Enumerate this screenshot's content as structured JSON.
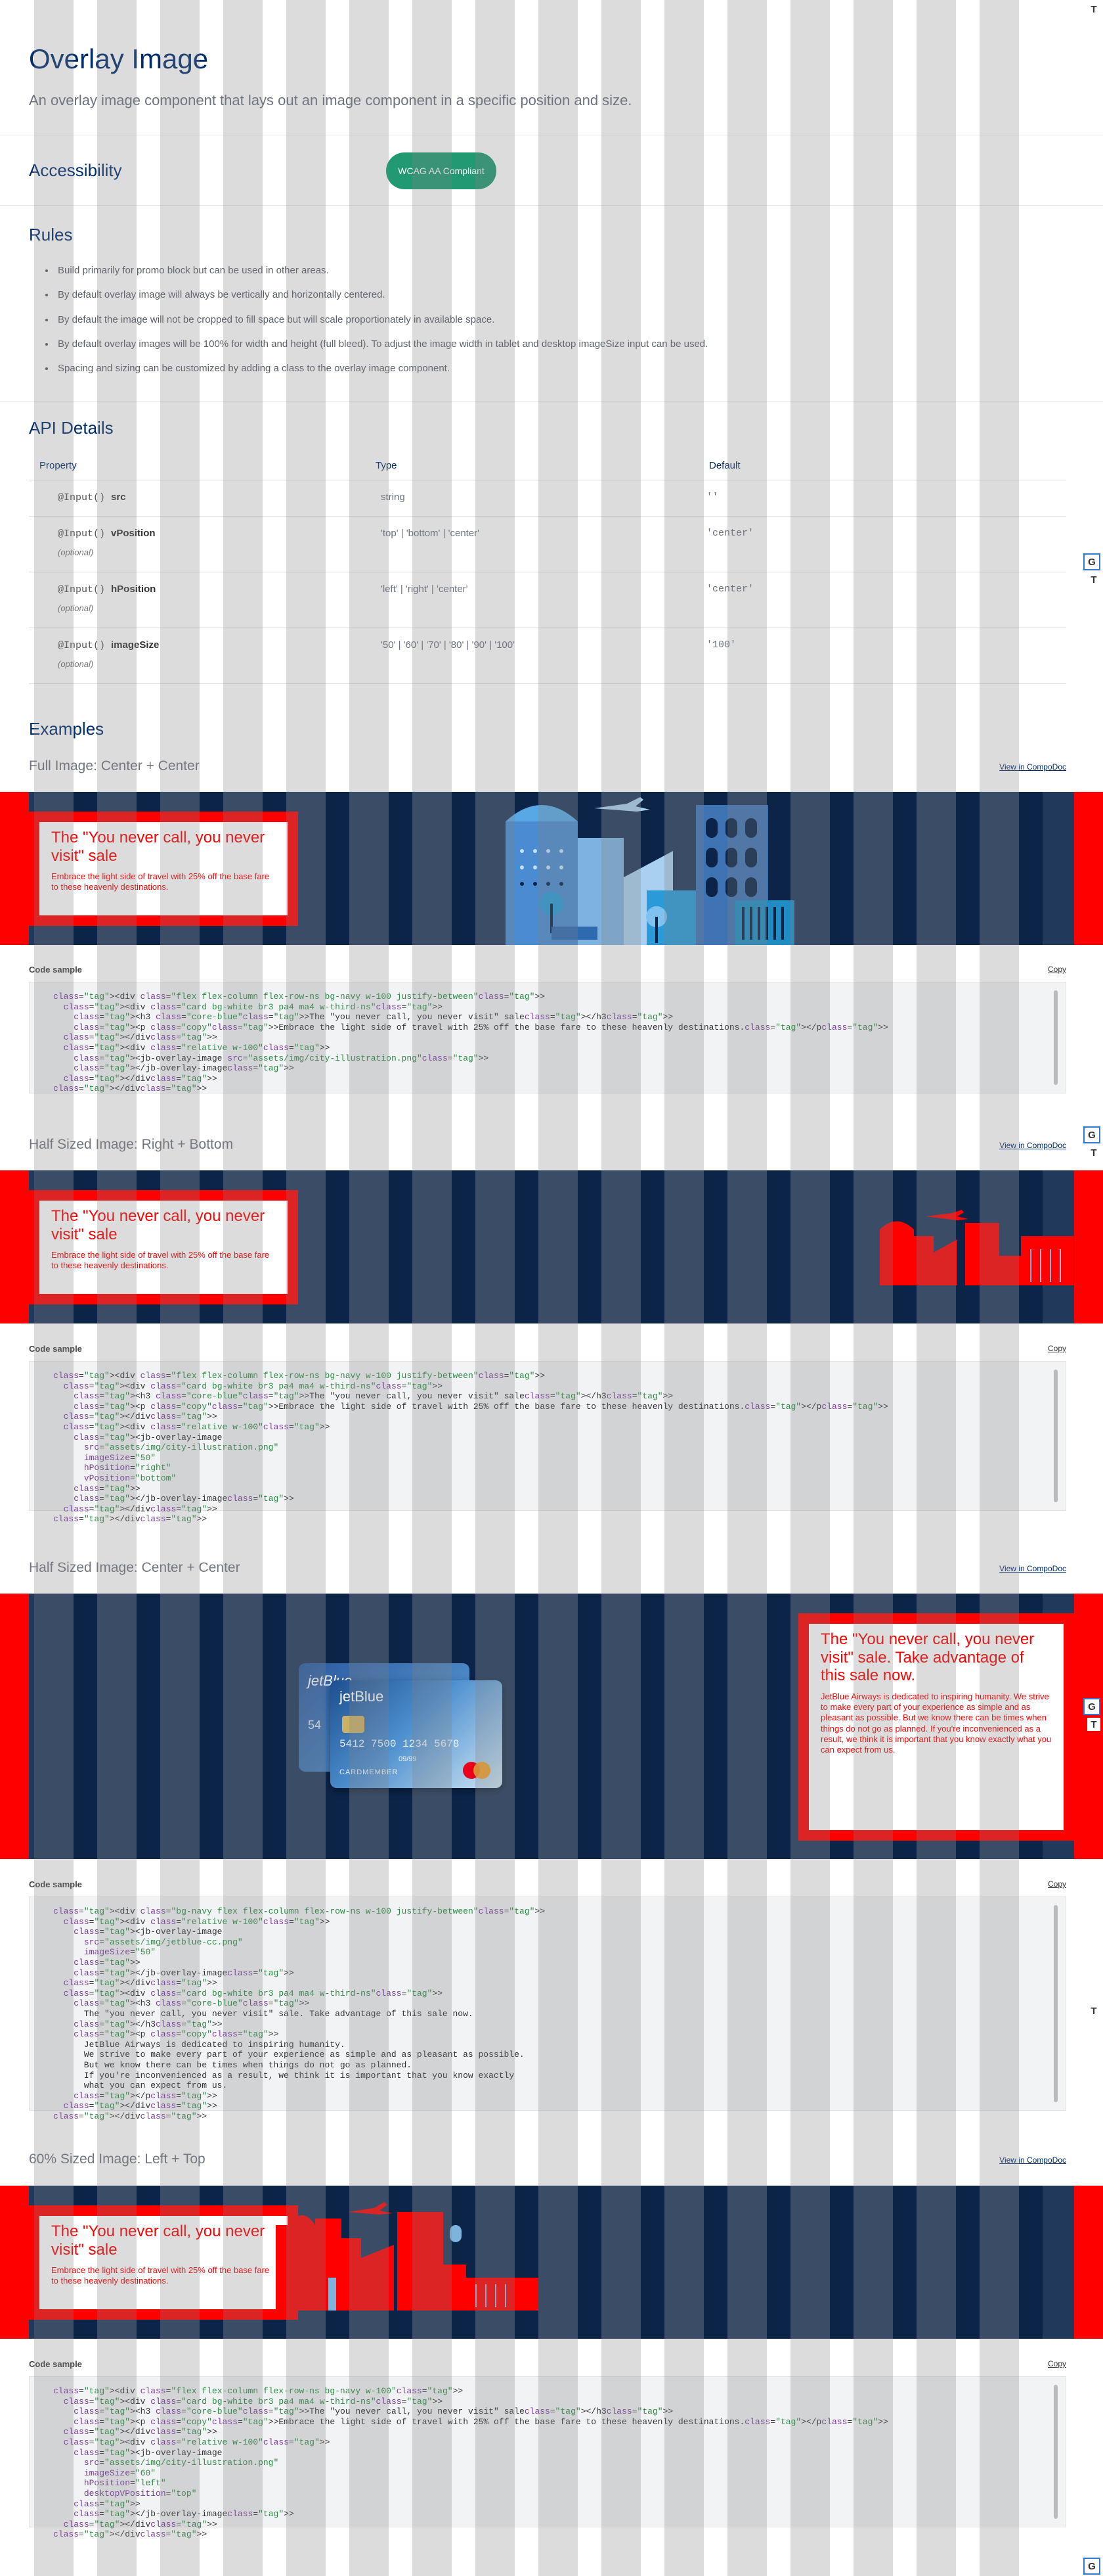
{
  "header": {
    "title": "Overlay Image",
    "lead": "An overlay image component that lays out an image component in a specific position and size."
  },
  "accessibility": {
    "title": "Accessibility",
    "badge": "WCAG AA Compliant"
  },
  "rules": {
    "title": "Rules",
    "items": [
      "Build primarily for promo block but can be used in other areas.",
      "By default overlay image will always be vertically and horizontally centered.",
      "By default the image will not be cropped to fill space but will scale proportionately in available space.",
      "By default overlay images will be 100% for width and height (full bleed). To adjust the image width in tablet and desktop imageSize input can be used.",
      "Spacing and sizing can be customized by adding a class to the overlay image component."
    ]
  },
  "api": {
    "title": "API Details",
    "columns": [
      "Property",
      "Type",
      "Default"
    ],
    "rows": [
      {
        "decorator": "@Input()",
        "name": "src",
        "optional": "",
        "type": "string",
        "default": "''"
      },
      {
        "decorator": "@Input()",
        "name": "vPosition",
        "optional": "(optional)",
        "type": "'top' | 'bottom' | 'center'",
        "default": "'center'"
      },
      {
        "decorator": "@Input()",
        "name": "hPosition",
        "optional": "(optional)",
        "type": "'left' | 'right' | 'center'",
        "default": "'center'"
      },
      {
        "decorator": "@Input()",
        "name": "imageSize",
        "optional": "(optional)",
        "type": "'50' | '60' | '70' | '80' | '90' | '100'",
        "default": "'100'"
      }
    ]
  },
  "examples": {
    "title": "Examples",
    "view_link": "View in CompoDoc",
    "code_label": "Code sample",
    "copy_label": "Copy",
    "card_title": "The \"You never call, you never visit\" sale",
    "card_copy": "Embrace the light side of travel with 25% off the base fare to these heavenly destinations.",
    "card_title_long": "The \"You never call, you never visit\" sale. Take advantage of this sale now.",
    "card_copy_long": "JetBlue Airways is dedicated to inspiring humanity. We strive to make every part of your experience as simple and as pleasant as possible. But we know there can be times when things do not go as planned. If you're inconvenienced as a result, we think it is important that you know exactly what you can expect from us.",
    "items": [
      {
        "title": "Full Image: Center + Center"
      },
      {
        "title": "Half Sized Image: Right + Bottom"
      },
      {
        "title": "Half Sized Image: Center + Center"
      },
      {
        "title": "60% Sized Image: Left + Top"
      }
    ]
  },
  "code": {
    "ex1": [
      "<div class=\"flex flex-column flex-row-ns bg-navy w-100 justify-between\">",
      "  <div class=\"card bg-white br3 pa4 ma4 w-third-ns\">",
      "    <h3 class=\"core-blue\">The \"you never call, you never visit\" sale</h3>",
      "    <p class=\"copy\">Embrace the light side of travel with 25% off the base fare to these heavenly destinations.</p>",
      "  </div>",
      "  <div class=\"relative w-100\">",
      "    <jb-overlay-image src=\"assets/img/city-illustration.png\">",
      "    </jb-overlay-image>",
      "  </div>",
      "</div>"
    ],
    "ex2": [
      "<div class=\"flex flex-column flex-row-ns bg-navy w-100 justify-between\">",
      "  <div class=\"card bg-white br3 pa4 ma4 w-third-ns\">",
      "    <h3 class=\"core-blue\">The \"you never call, you never visit\" sale</h3>",
      "    <p class=\"copy\">Embrace the light side of travel with 25% off the base fare to these heavenly destinations.</p>",
      "  </div>",
      "  <div class=\"relative w-100\">",
      "    <jb-overlay-image",
      "      src=\"assets/img/city-illustration.png\"",
      "      imageSize=\"50\"",
      "      hPosition=\"right\"",
      "      vPosition=\"bottom\"",
      "    >",
      "    </jb-overlay-image>",
      "  </div>",
      "</div>"
    ],
    "ex3": [
      "<div class=\"bg-navy flex flex-column flex-row-ns w-100 justify-between\">",
      "  <div class=\"relative w-100\">",
      "    <jb-overlay-image",
      "      src=\"assets/img/jetblue-cc.png\"",
      "      imageSize=\"50\"",
      "    >",
      "    </jb-overlay-image>",
      "  </div>",
      "  <div class=\"card bg-white br3 pa4 ma4 w-third-ns\">",
      "    <h3 class=\"core-blue\">",
      "      The \"you never call, you never visit\" sale. Take advantage of this sale now.",
      "    </h3>",
      "    <p class=\"copy\">",
      "      JetBlue Airways is dedicated to inspiring humanity.",
      "      We strive to make every part of your experience as simple and as pleasant as possible.",
      "      But we know there can be times when things do not go as planned.",
      "      If you're inconvenienced as a result, we think it is important that you know exactly",
      "      what you can expect from us.",
      "    </p>",
      "  </div>",
      "</div>"
    ],
    "ex4": [
      "<div class=\"flex flex-column flex-row-ns bg-navy w-100\">",
      "  <div class=\"card bg-white br3 pa4 ma4 w-third-ns\">",
      "    <h3 class=\"core-blue\">The \"you never call, you never visit\" sale</h3>",
      "    <p class=\"copy\">Embrace the light side of travel with 25% off the base fare to these heavenly destinations.</p>",
      "  </div>",
      "  <div class=\"relative w-100\">",
      "    <jb-overlay-image",
      "      src=\"assets/img/city-illustration.png\"",
      "      imageSize=\"60\"",
      "      hPosition=\"left\"",
      "      desktopVPosition=\"top\"",
      "    >",
      "    </jb-overlay-image>",
      "  </div>",
      "</div>"
    ]
  },
  "credit_card": {
    "brand": "jetBlue",
    "number": "5412 7500 1234 5678",
    "expiry": "09/99",
    "holder": "CARDMEMBER"
  },
  "toggles": {
    "t": "T",
    "g": "G"
  },
  "colors": {
    "navy": "#213a5c",
    "dark_navy": "#0b2448",
    "core_blue": "#002e6d",
    "green": "#219a73",
    "debug_red": "#ff0000"
  }
}
